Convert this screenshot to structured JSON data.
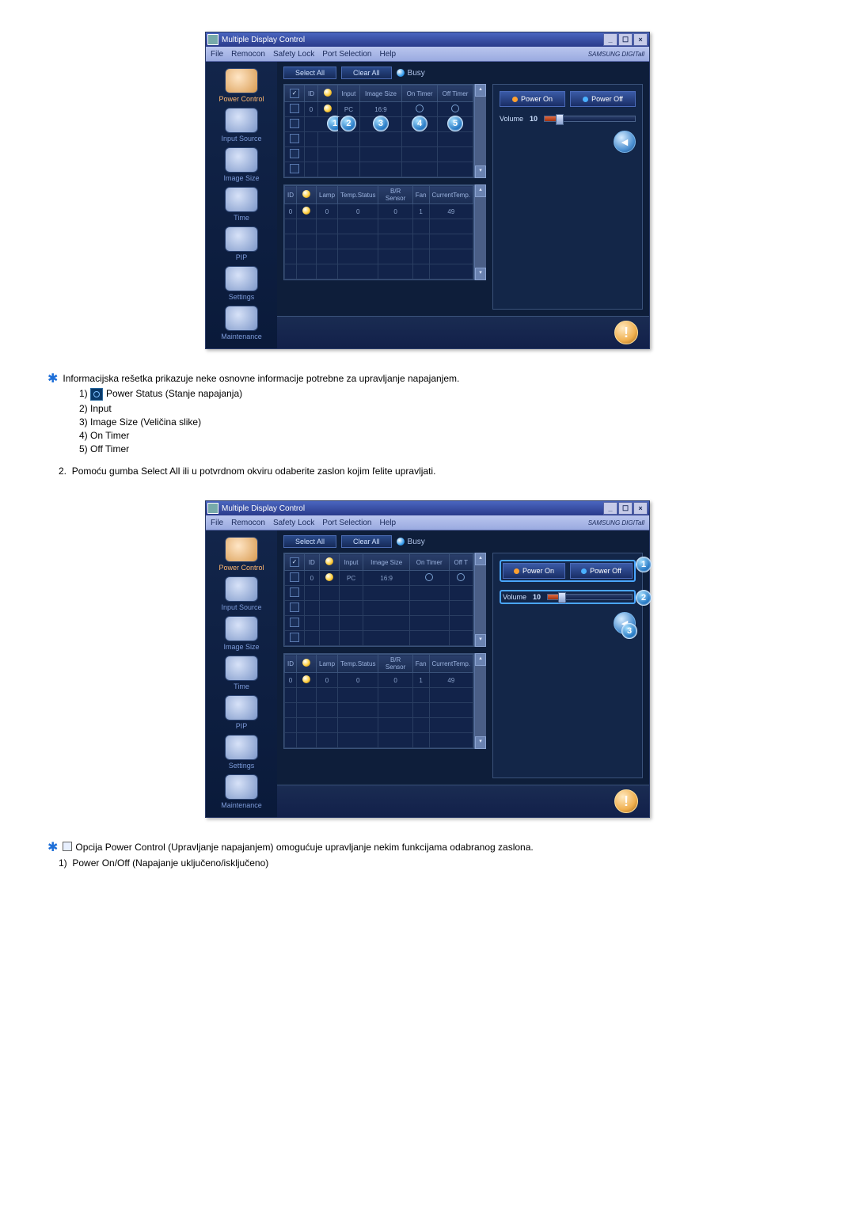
{
  "window": {
    "title": "Multiple Display Control",
    "menus": [
      "File",
      "Remocon",
      "Safety Lock",
      "Port Selection",
      "Help"
    ],
    "brand": "SAMSUNG DIGITall"
  },
  "sidebar": {
    "items": [
      {
        "label": "Power Control"
      },
      {
        "label": "Input Source"
      },
      {
        "label": "Image Size"
      },
      {
        "label": "Time"
      },
      {
        "label": "PIP"
      },
      {
        "label": "Settings"
      },
      {
        "label": "Maintenance"
      }
    ]
  },
  "toolbar": {
    "select_all": "Select All",
    "clear_all": "Clear All",
    "busy": "Busy"
  },
  "grid1": {
    "headers": [
      "",
      "ID",
      "",
      "Input",
      "Image Size",
      "On Timer",
      "Off Timer"
    ],
    "row": {
      "id": "0",
      "input": "PC",
      "image_size": "16:9"
    },
    "markers": [
      "1",
      "2",
      "3",
      "4",
      "5"
    ]
  },
  "grid2": {
    "headers": [
      "ID",
      "",
      "Lamp",
      "Temp.Status",
      "B/R Sensor",
      "Fan",
      "CurrentTemp."
    ],
    "row": {
      "id": "0",
      "lamp": "0",
      "temp_status": "0",
      "br": "0",
      "fan": "1",
      "cur": "49"
    }
  },
  "right": {
    "power_on": "Power On",
    "power_off": "Power Off",
    "volume_label": "Volume",
    "volume_value": "10"
  },
  "doc": {
    "note1_intro": "Informacijska rešetka prikazuje neke osnovne informacije potrebne za upravljanje napajanjem.",
    "note1_items": [
      "Power Status (Stanje napajanja)",
      "Input",
      "Image Size (Veličina slike)",
      "On Timer",
      "Off Timer"
    ],
    "step2": "Pomoću gumba Select All ili u potvrdnom okviru odaberite zaslon kojim ľelite upravljati.",
    "note2": "Opcija Power Control (Upravljanje napajanjem) omogućuje upravljanje nekim funkcijama odabranog zaslona.",
    "note2_item1": "Power On/Off (Napajanje uključeno/isključeno)"
  },
  "markers2": [
    "1",
    "2",
    "3"
  ]
}
